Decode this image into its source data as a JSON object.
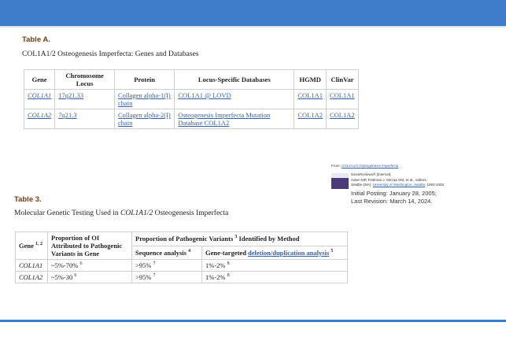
{
  "tableA": {
    "label": "Table A.",
    "caption": "COL1A1/2 Osteogenesis Imperfecta: Genes and Databases",
    "headers": [
      "Gene",
      "Chromosome Locus",
      "Protein",
      "Locus-Specific Databases",
      "HGMD",
      "ClinVar"
    ],
    "rows": [
      [
        "COL1A1",
        "17q21.33",
        "Collagen alpha-1(I) chain",
        "COL1A1 @ LOVD",
        "COL1A1",
        "COL1A1"
      ],
      [
        "COL1A2",
        "7q21.3",
        "Collagen alpha-2(I) chain",
        "Osteogenesis Imperfecta Mutation Database COL1A2",
        "COL1A2",
        "COL1A2"
      ]
    ]
  },
  "citation": {
    "from_label": "From:",
    "from_link": "COL1A1/2 Osteogenesis Imperfecta",
    "line1": "GeneReviews® [Internet].",
    "line2": "Adam MP, Feldman J, Mirzaa GM, et al., editors.",
    "line3_prefix": "Seattle (WA): ",
    "line3_link": "University of Washington, Seattle",
    "line3_suffix": "; 1993-2025.",
    "initial_posting": "Initial Posting: January 28, 2005;",
    "last_revision": "Last Revision: March 14, 2024."
  },
  "tableB": {
    "label": "Table 3.",
    "caption_prefix": "Molecular Genetic Testing Used in ",
    "caption_gene": "COL1A1/2",
    "caption_suffix": " Osteogenesis Imperfecta",
    "header_gene": "Gene",
    "header_gene_sup": "1, 2",
    "header_proportion_oi": "Proportion of OI Attributed to Pathogenic Variants in Gene",
    "header_group_prefix": "Proportion of Pathogenic Variants",
    "header_group_sup": "3",
    "header_group_suffix": " Identified by Method",
    "header_seq": "Sequence analysis",
    "header_seq_sup": "4",
    "header_del_prefix": "Gene-targeted ",
    "header_del_link": "deletion/duplication analysis",
    "header_del_sup": "5",
    "rows": [
      {
        "gene": "COL1A1",
        "oi": "~5%-70%",
        "oi_sup": "6",
        "seq": ">95%",
        "seq_sup": "7",
        "del": "1%-2%",
        "del_sup": "8"
      },
      {
        "gene": "COL1A2",
        "oi": "~5%-30",
        "oi_sup": "6",
        "seq": ">95%",
        "seq_sup": "7",
        "del": "1%-2%",
        "del_sup": "8"
      }
    ]
  }
}
